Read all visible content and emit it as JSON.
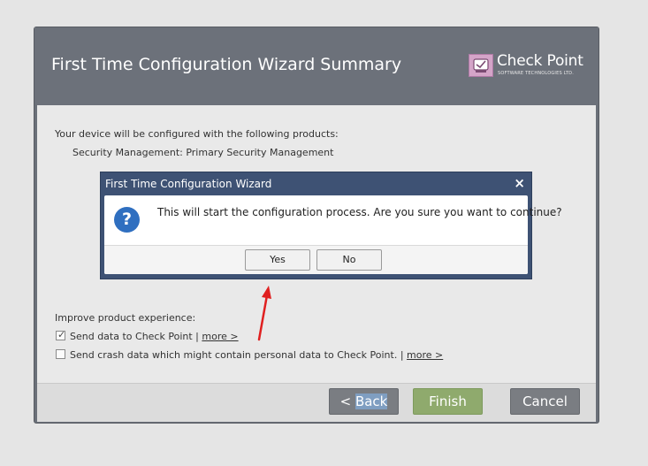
{
  "wizard": {
    "title": "First Time Configuration Wizard Summary",
    "logo": {
      "name": "Check Point",
      "subtitle": "SOFTWARE TECHNOLOGIES LTD."
    },
    "body": {
      "intro": "Your device will be configured with the following products:",
      "products": [
        "Security Management: Primary Security Management"
      ],
      "improve_heading": "Improve product experience:",
      "options": [
        {
          "label": "Send data to Check Point |",
          "link": "more >",
          "checked": true
        },
        {
          "label": "Send crash data which might contain personal data to Check Point. |",
          "link": "more >",
          "checked": false
        }
      ]
    },
    "footer": {
      "back_label": "< Back",
      "finish_label": "Finish",
      "cancel_label": "Cancel"
    }
  },
  "dialog": {
    "title": "First Time Configuration Wizard",
    "close_glyph": "×",
    "icon_glyph": "?",
    "message": "This will start the configuration process. Are you sure you want to continue?",
    "yes_label": "Yes",
    "no_label": "No"
  },
  "colors": {
    "header": "#6c717a",
    "dialog_title_bar": "#3e5274",
    "finish_button": "#8faa6d",
    "question_icon": "#2f6fc0",
    "annotation_arrow": "#e02020"
  }
}
